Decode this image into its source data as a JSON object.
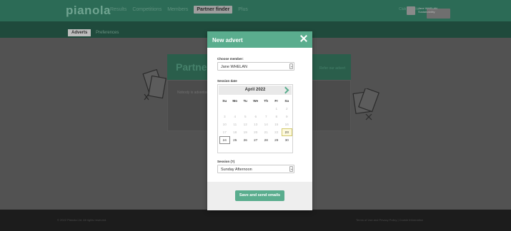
{
  "nav": {
    "logo": "pianola",
    "items": [
      "Results",
      "Competitions",
      "Members",
      "Partner finder",
      "Plus"
    ],
    "active_index": 3,
    "right_text": "Club website",
    "user_text": "Jane WHELAN Sustainability"
  },
  "subnav": {
    "tabs": [
      "Adverts",
      "Preferences"
    ],
    "active_index": 0
  },
  "page": {
    "heading": "Partner",
    "heading_right": "Refer our advert",
    "panel_text": "Nobody is advertising"
  },
  "footer": {
    "left": "© 2022 Pianola Ltd. All rights reserved.",
    "right": "Terms of Use and Privacy Policy | Cookie Information"
  },
  "modal": {
    "title": "New advert",
    "member_label": "Choose member:",
    "member_value": "Jane WHELAN",
    "session_date_label": "Session date",
    "session_label": "Session (?)",
    "session_value": "Sunday Afternoon",
    "save_label": "Save and send emails"
  },
  "calendar": {
    "month": "April 2022",
    "weekdays": [
      "Su",
      "Mo",
      "Tu",
      "We",
      "Th",
      "Fr",
      "Sa"
    ],
    "weeks": [
      [
        "",
        "",
        "",
        "",
        "",
        "1",
        "2"
      ],
      [
        "3",
        "4",
        "5",
        "6",
        "7",
        "8",
        "9"
      ],
      [
        "10",
        "11",
        "12",
        "13",
        "14",
        "15",
        "16"
      ],
      [
        "17",
        "18",
        "19",
        "20",
        "21",
        "22",
        "23"
      ],
      [
        "24",
        "25",
        "26",
        "27",
        "28",
        "29",
        "30"
      ]
    ],
    "today": "23",
    "selected": "24"
  },
  "colors": {
    "accent": "#5aad8e",
    "navbar": "#2c6b56",
    "subnav": "#1f4a3c"
  }
}
